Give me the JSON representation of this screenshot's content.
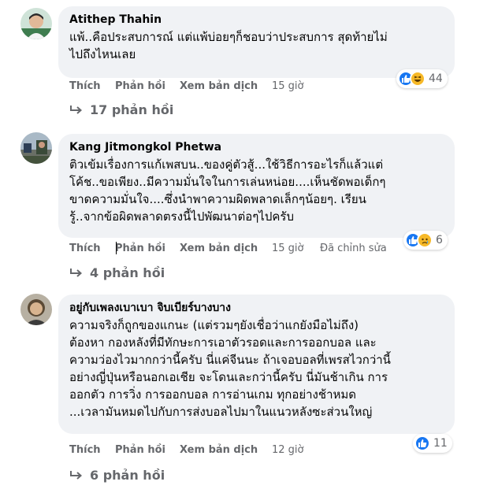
{
  "comments": [
    {
      "author": "Atithep Thahin",
      "lines": [
        "แพ้..คือประสบการณ์ แต่แพ้บ่อยๆก็ชอบว่าประสบการ สุดท้ายไม่",
        "ไปถึงไหนเลย"
      ],
      "actions": {
        "like": "Thích",
        "reply": "Phản hồi",
        "translate": "Xem bản dịch",
        "time": "15 giờ"
      },
      "reactions": {
        "count": "44",
        "icons": [
          "like-icon",
          "laugh-icon"
        ]
      },
      "replies": "17 phản hồi"
    },
    {
      "author": "Kang Jitmongkol Phetwa",
      "lines": [
        "ติวเข้มเรื่องการแก้เพสบน..ของคู่ตัวสู้...ใช้วิธีการอะไรก็แล้วแต่",
        "โค้ช..ขอเพียง..มีความมั่นใจในการเล่นหน่อย....เห็นชัดพอเด็กๆ",
        "ขาดความมั่นใจ....ซึ่งนำพาความผิดพลาดเล็กๆน้อยๆ. เรียน",
        "รู้..จากข้อผิดพลาดตรงนี้ไปพัฒนาต่อๆไปครับ"
      ],
      "actions": {
        "like": "Thích",
        "reply": "Phản hồi",
        "translate": "Xem bản dịch",
        "time": "15 giờ",
        "edited": "Đã chỉnh sửa"
      },
      "reactions": {
        "count": "6",
        "icons": [
          "like-icon",
          "sad-icon"
        ]
      },
      "replies": "4 phản hồi"
    },
    {
      "author": "อยู่กับเพลงเบาเบา จิบเบียร์บางบาง",
      "lines": [
        "ความจริงก็ถูกของแกนะ (แต่รวมๆยังเชื่อว่าแกยังมือไม่ถึง)",
        "ต้องหา กองหลังที่มีทักษะการเอาตัวรอดและการออกบอล และ",
        "ความว่องไวมากกว่านี้ครับ นี่แค่จีนนะ ถ้าเจอบอลที่เพรสไวกว่านี้",
        "อย่างญี่ปุ่นหรือนอกเอเชีย จะโดนเละกว่านี้ครับ นี่มันช้าเกิน การ",
        "ออกตัว การวิ่ง การออกบอล การอ่านเกม ทุกอย่างช้าหมด",
        "...เวลามันหมดไปกับการส่งบอลไปมาในแนวหลังซะส่วนใหญ่"
      ],
      "actions": {
        "like": "Thích",
        "reply": "Phản hồi",
        "translate": "Xem bản dịch",
        "time": "12 giờ"
      },
      "reactions": {
        "count": "11",
        "icons": [
          "like-icon"
        ]
      },
      "replies": "6 phản hồi"
    }
  ],
  "colors": {
    "bubble": "#f0f2f5",
    "meta": "#65676b",
    "like": "#1877f2",
    "emoji": "#f7b928"
  }
}
